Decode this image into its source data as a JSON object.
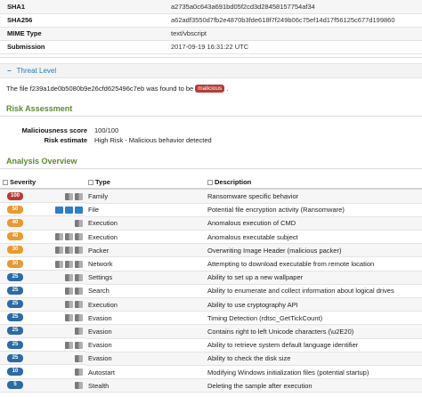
{
  "file_info": [
    {
      "key": "SHA1",
      "value": "a2735a0c643a691bd05f2cd3d28458157754af34"
    },
    {
      "key": "SHA256",
      "value": "a62adf3550d7fb2e4870b3fde618f7f249b06c75ef14d17f56125c677d199860"
    },
    {
      "key": "MIME Type",
      "value": "text/vbscript"
    },
    {
      "key": "Submission",
      "value": "2017-09-19 16:31:22 UTC"
    }
  ],
  "threat_level": {
    "toggle": "−",
    "title": "Threat Level",
    "found_prefix": "The file f239a1de0b5080b9e26cfd625496c7eb was found to be",
    "verdict": "malicious",
    "found_suffix": "."
  },
  "risk": {
    "title": "Risk Assessment",
    "rows": [
      {
        "key": "Maliciousness score",
        "value": "100/100"
      },
      {
        "key": "Risk estimate",
        "value": "High Risk - Malicious behavior detected"
      }
    ]
  },
  "analysis": {
    "title": "Analysis Overview",
    "headers": {
      "severity": "Severity",
      "type": "Type",
      "description": "Description"
    },
    "rows": [
      {
        "severity": "100",
        "color": "#b73b39",
        "platforms": [
          "win-7",
          "win-7"
        ],
        "type": "Family",
        "description": "Ransomware specific behavior"
      },
      {
        "severity": "50",
        "color": "#e99a2f",
        "platforms": [
          "win-10",
          "win-10",
          "win-10"
        ],
        "type": "File",
        "description": "Potential file encryption activity (Ransomware)"
      },
      {
        "severity": "40",
        "color": "#e99a2f",
        "platforms": [
          "win-7"
        ],
        "type": "Execution",
        "description": "Anomalous execution of CMD"
      },
      {
        "severity": "40",
        "color": "#e99a2f",
        "platforms": [
          "win-7",
          "win-7",
          "win-7"
        ],
        "type": "Execution",
        "description": "Anomalous executable subject"
      },
      {
        "severity": "30",
        "color": "#e99a2f",
        "platforms": [
          "win-7",
          "win-7",
          "win-7"
        ],
        "type": "Packer",
        "description": "Overwriting Image Header (malicious packer)"
      },
      {
        "severity": "30",
        "color": "#e99a2f",
        "platforms": [
          "win-7",
          "win-7",
          "win-7"
        ],
        "type": "Network",
        "description": "Attempting to download executable from remote location"
      },
      {
        "severity": "25",
        "color": "#2c6aa8",
        "platforms": [
          "win-7",
          "win-7"
        ],
        "type": "Settings",
        "description": "Ability to set up a new wallpaper"
      },
      {
        "severity": "25",
        "color": "#2c6aa8",
        "platforms": [
          "win-7",
          "win-7"
        ],
        "type": "Search",
        "description": "Ability to enumerate and collect information about logical drives"
      },
      {
        "severity": "25",
        "color": "#2c6aa8",
        "platforms": [
          "win-7",
          "win-7"
        ],
        "type": "Execution",
        "description": "Ability to use cryptography API"
      },
      {
        "severity": "25",
        "color": "#2c6aa8",
        "platforms": [
          "win-7",
          "win-7"
        ],
        "type": "Evasion",
        "description": "Timing Detection (rdtsc_GetTickCount)"
      },
      {
        "severity": "25",
        "color": "#2c6aa8",
        "platforms": [
          "win-7"
        ],
        "type": "Evasion",
        "description": "Contains right to left Unicode characters (\\u2E20)"
      },
      {
        "severity": "25",
        "color": "#2c6aa8",
        "platforms": [
          "win-7",
          "win-7"
        ],
        "type": "Evasion",
        "description": "Ability to retrieve system default language identifier"
      },
      {
        "severity": "25",
        "color": "#2c6aa8",
        "platforms": [
          "win-7"
        ],
        "type": "Evasion",
        "description": "Ability to check the disk size"
      },
      {
        "severity": "10",
        "color": "#2c6aa8",
        "platforms": [
          "win-7"
        ],
        "type": "Autostart",
        "description": "Modifying Windows initialization files (potential startup)"
      },
      {
        "severity": "5",
        "color": "#2c6aa8",
        "platforms": [
          "win-7"
        ],
        "type": "Stealth",
        "description": "Deleting the sample after execution"
      }
    ]
  }
}
